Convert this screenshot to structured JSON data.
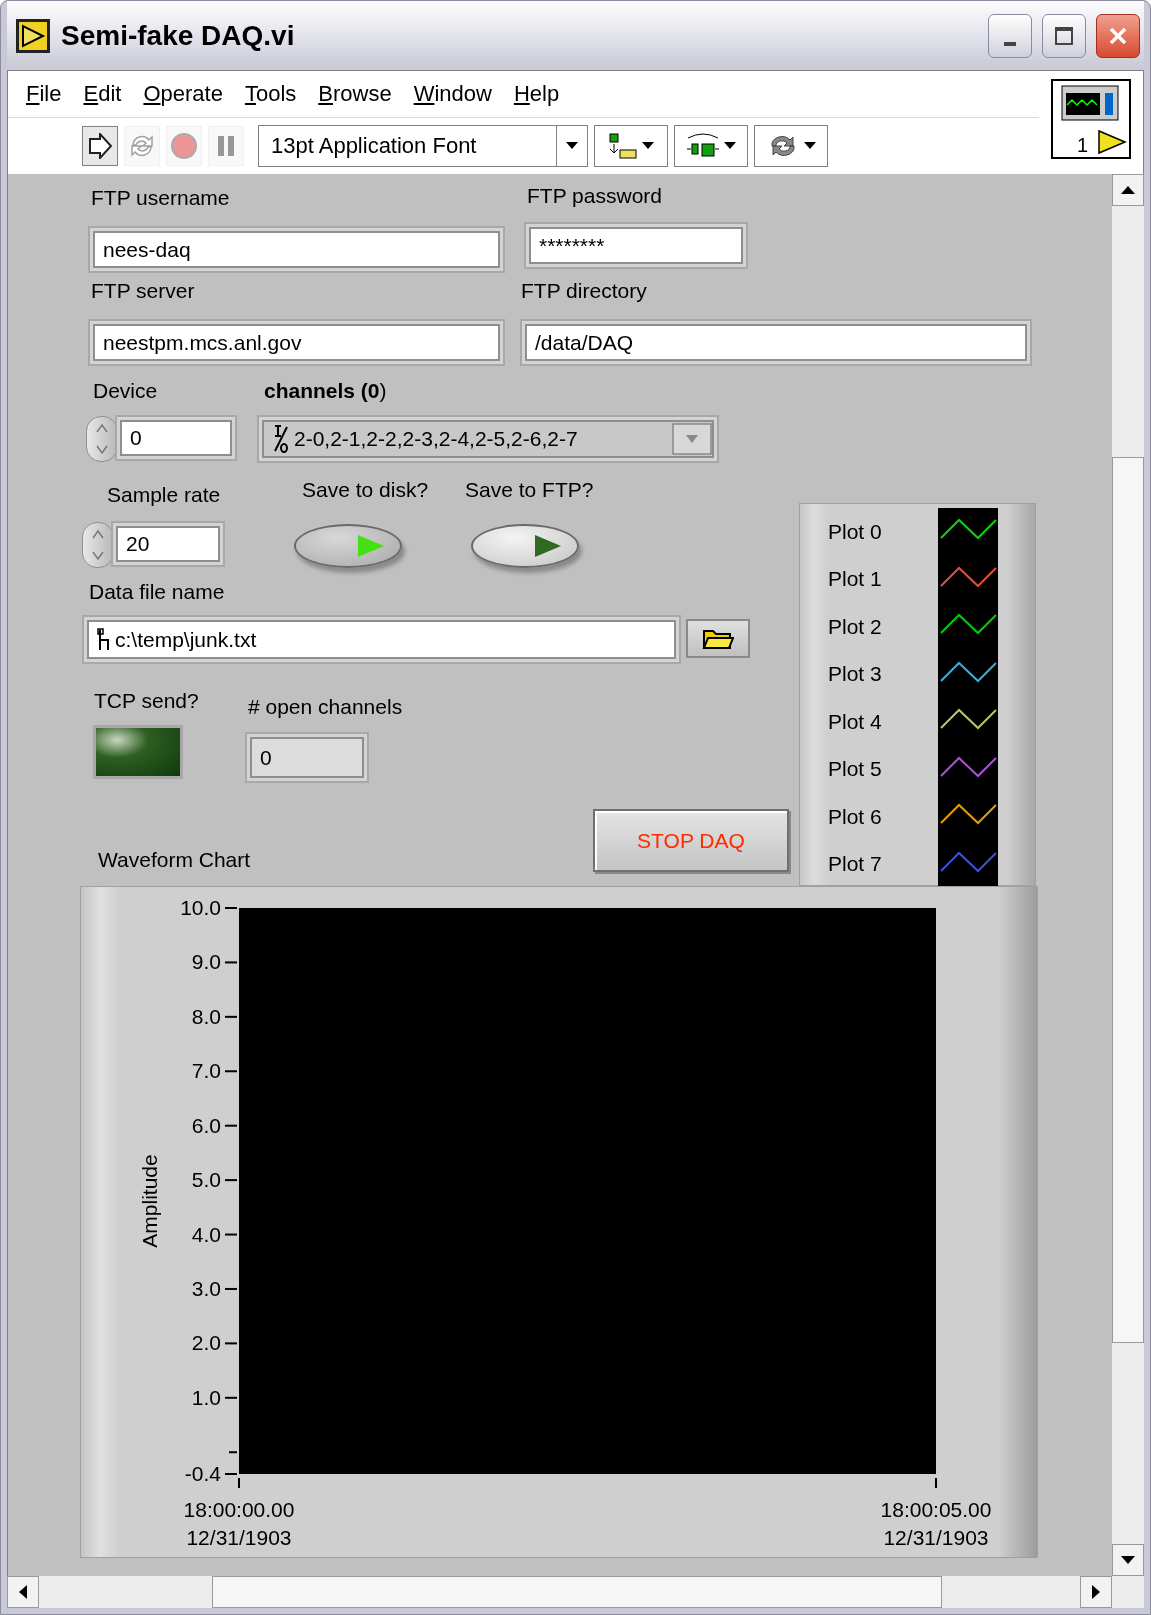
{
  "window": {
    "title": "Semi-fake DAQ.vi"
  },
  "menu": [
    "File",
    "Edit",
    "Operate",
    "Tools",
    "Browse",
    "Window",
    "Help"
  ],
  "tools": [
    {
      "kind": "run",
      "disabled": false
    },
    {
      "kind": "run_continuously",
      "disabled": true
    },
    {
      "kind": "abort",
      "disabled": true
    },
    {
      "kind": "pause",
      "disabled": true
    }
  ],
  "font_menu": {
    "value": "13pt Application Font"
  },
  "arrange_tools": [
    {
      "kind": "align"
    },
    {
      "kind": "distribute"
    },
    {
      "kind": "reorder"
    }
  ],
  "vi_icon": {
    "connector": "1"
  },
  "ftp_username": {
    "label": "FTP username",
    "value": "nees-daq"
  },
  "ftp_password": {
    "label": "FTP password",
    "value": "********"
  },
  "ftp_server": {
    "label": "FTP server",
    "value": "neestpm.mcs.anl.gov"
  },
  "ftp_directory": {
    "label": "FTP directory",
    "value": "/data/DAQ"
  },
  "device": {
    "label": "Device",
    "value": "0"
  },
  "channels": {
    "label": "**channels (0**)",
    "value": "2-0,2-1,2-2,2-3,2-4,2-5,2-6,2-7"
  },
  "sample_rate": {
    "label": "Sample rate",
    "value": "20"
  },
  "save_to_disk": {
    "label": "Save to disk?",
    "on": true
  },
  "save_to_ftp": {
    "label": "Save to FTP?",
    "on": false
  },
  "data_file_name": {
    "label": "Data file name",
    "value": "c:\\temp\\junk.txt"
  },
  "tcp_send": {
    "label": "TCP send?",
    "on": false
  },
  "open_channels": {
    "label": "# open channels",
    "value": "0"
  },
  "stop_button": {
    "label": "STOP DAQ"
  },
  "legend": [
    {
      "name": "Plot 0",
      "color": "#14d014"
    },
    {
      "name": "Plot 1",
      "color": "#e0503c"
    },
    {
      "name": "Plot 2",
      "color": "#00d000"
    },
    {
      "name": "Plot 3",
      "color": "#38b0d8"
    },
    {
      "name": "Plot 4",
      "color": "#b8c860"
    },
    {
      "name": "Plot 5",
      "color": "#b050d8"
    },
    {
      "name": "Plot 6",
      "color": "#e0a000"
    },
    {
      "name": "Plot 7",
      "color": "#3c50e8"
    }
  ],
  "chart": {
    "label": "Waveform Chart",
    "chart_data": {
      "type": "line",
      "ylabel": "Amplitude",
      "ylim": [
        -0.4,
        10
      ],
      "categories": [
        "18:00:00.00\n12/31/1903",
        "18:00:05.00\n12/31/1903"
      ],
      "yticks": [
        {
          "value": 10,
          "label": "10.0"
        },
        {
          "value": 9,
          "label": "9.0"
        },
        {
          "value": 8,
          "label": "8.0"
        },
        {
          "value": 7,
          "label": "7.0"
        },
        {
          "value": 6,
          "label": "6.0"
        },
        {
          "value": 5,
          "label": "5.0"
        },
        {
          "value": 4,
          "label": "4.0"
        },
        {
          "value": 3,
          "label": "3.0"
        },
        {
          "value": 2,
          "label": "2.0"
        },
        {
          "value": 1,
          "label": "1.0"
        },
        {
          "value": -0.4,
          "label": "-0.4"
        }
      ]
    }
  }
}
